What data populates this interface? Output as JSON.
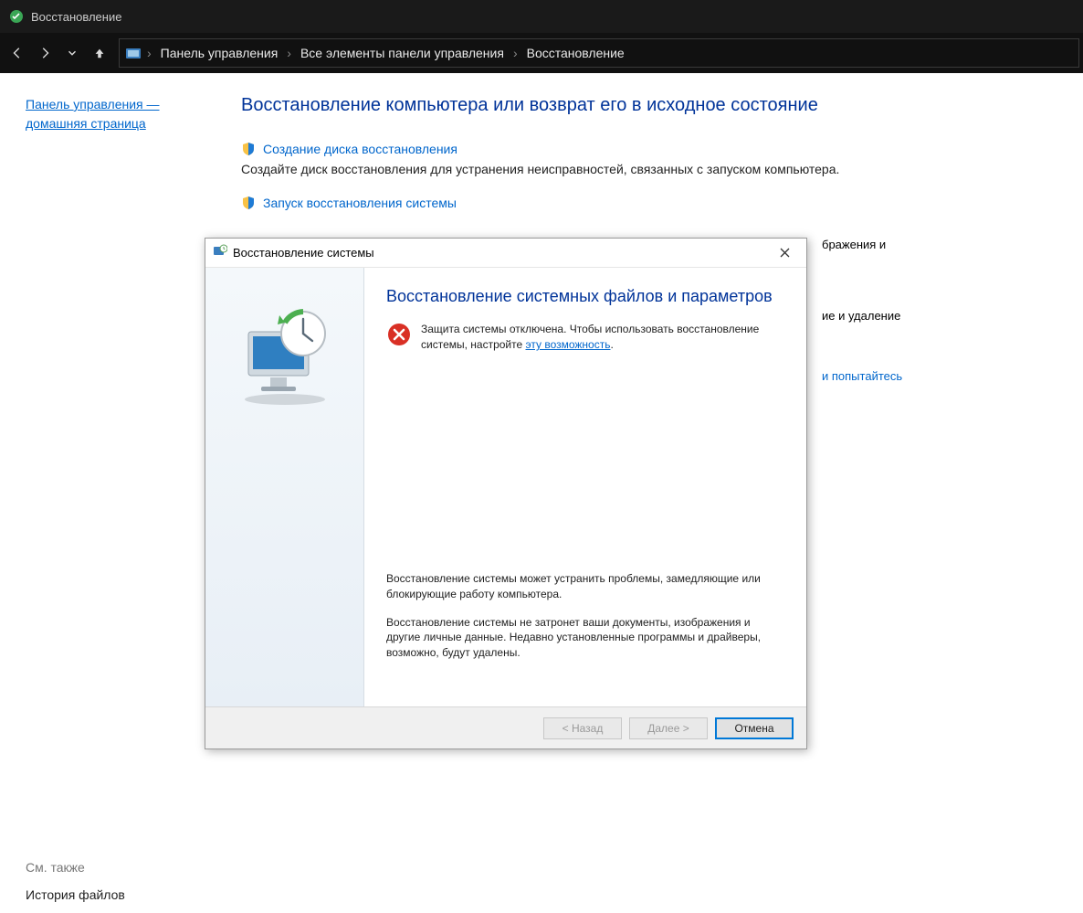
{
  "titlebar": {
    "title": "Восстановление"
  },
  "navbar": {
    "crumbs": [
      "Панель управления",
      "Все элементы панели управления",
      "Восстановление"
    ]
  },
  "sidebar": {
    "home_link": "Панель управления — домашняя страница",
    "see_also": "См. также",
    "history_link": "История файлов"
  },
  "main": {
    "page_title": "Восстановление компьютера или возврат его в исходное состояние",
    "items": [
      {
        "link": "Создание диска восстановления",
        "desc": "Создайте диск восстановления для устранения неисправностей, связанных с запуском компьютера."
      },
      {
        "link": "Запуск восстановления системы",
        "desc_fragment_right": "бражения и",
        "desc_hidden_start": ""
      },
      {
        "desc_fragment_right1": "ие и удаление"
      },
      {
        "desc_fragment_right2": "и попытайтесь"
      }
    ]
  },
  "dialog": {
    "title": "Восстановление системы",
    "heading": "Восстановление системных файлов и параметров",
    "warning_text_before": "Защита системы отключена. Чтобы использовать восстановление системы, настройте ",
    "warning_link": "эту возможность",
    "warning_text_after": ".",
    "para1": "Восстановление системы может устранить проблемы, замедляющие или блокирующие работу компьютера.",
    "para2": "Восстановление системы не затронет ваши документы, изображения и другие личные данные. Недавно установленные программы и драйверы, возможно, будут удалены.",
    "buttons": {
      "back": "< Назад",
      "next": "Далее >",
      "cancel": "Отмена"
    }
  }
}
